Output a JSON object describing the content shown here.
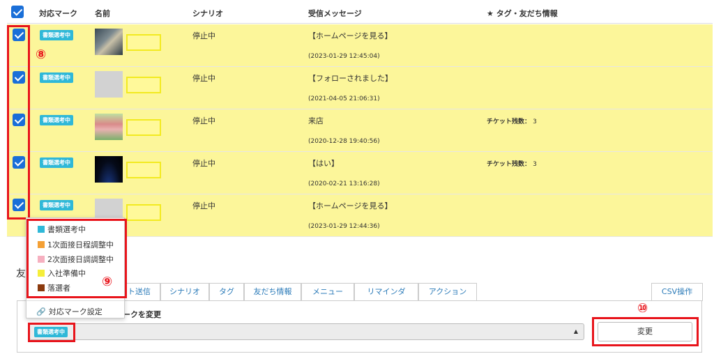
{
  "header": {
    "col_mark": "対応マーク",
    "col_name": "名前",
    "col_scenario": "シナリオ",
    "col_message": "受信メッセージ",
    "col_tags": "★ タグ・友だち情報"
  },
  "rows": [
    {
      "badge": "書類選考中",
      "scenario": "停止中",
      "message": "【ホームページを見る】",
      "time": "(2023-01-29 12:45:04)",
      "tag_label": "",
      "tag_value": ""
    },
    {
      "badge": "書類選考中",
      "scenario": "停止中",
      "message": "【フォローされました】",
      "time": "(2021-04-05 21:06:31)",
      "tag_label": "",
      "tag_value": ""
    },
    {
      "badge": "書類選考中",
      "scenario": "停止中",
      "message": "来店",
      "time": "(2020-12-28 19:40:56)",
      "tag_label": "チケット残数：",
      "tag_value": "3"
    },
    {
      "badge": "書類選考中",
      "scenario": "停止中",
      "message": "【はい】",
      "time": "(2020-02-21 13:16:28)",
      "tag_label": "チケット残数：",
      "tag_value": "3"
    },
    {
      "badge": "書類選考中",
      "scenario": "停止中",
      "message": "【ホームページを見る】",
      "time": "(2023-01-29 12:44:36)",
      "tag_label": "",
      "tag_value": ""
    }
  ],
  "annotations": {
    "n8": "⑧",
    "n9": "⑨",
    "n10": "⑩"
  },
  "dropdown": {
    "items": [
      {
        "label": "書類選考中",
        "color": "#2fb8d8"
      },
      {
        "label": "1次面接日程調整中",
        "color": "#f4a035"
      },
      {
        "label": "2次面接日調調整中",
        "color": "#f6b0c0"
      },
      {
        "label": "入社準備中",
        "color": "#f5ee3a"
      },
      {
        "label": "落選者",
        "color": "#8b3a0e"
      }
    ],
    "settings_label": "対応マーク設定"
  },
  "friends": {
    "label": "友"
  },
  "tabs": {
    "t1": "ト送信",
    "t2": "シナリオ",
    "t3": "タグ",
    "t4": "友だち情報",
    "t5": "メニュー",
    "t6": "リマインダ",
    "t7": "アクション",
    "csv": "CSV操作"
  },
  "panel": {
    "title": "ークを変更",
    "selected_badge": "書類選考中",
    "change_button": "変更"
  }
}
